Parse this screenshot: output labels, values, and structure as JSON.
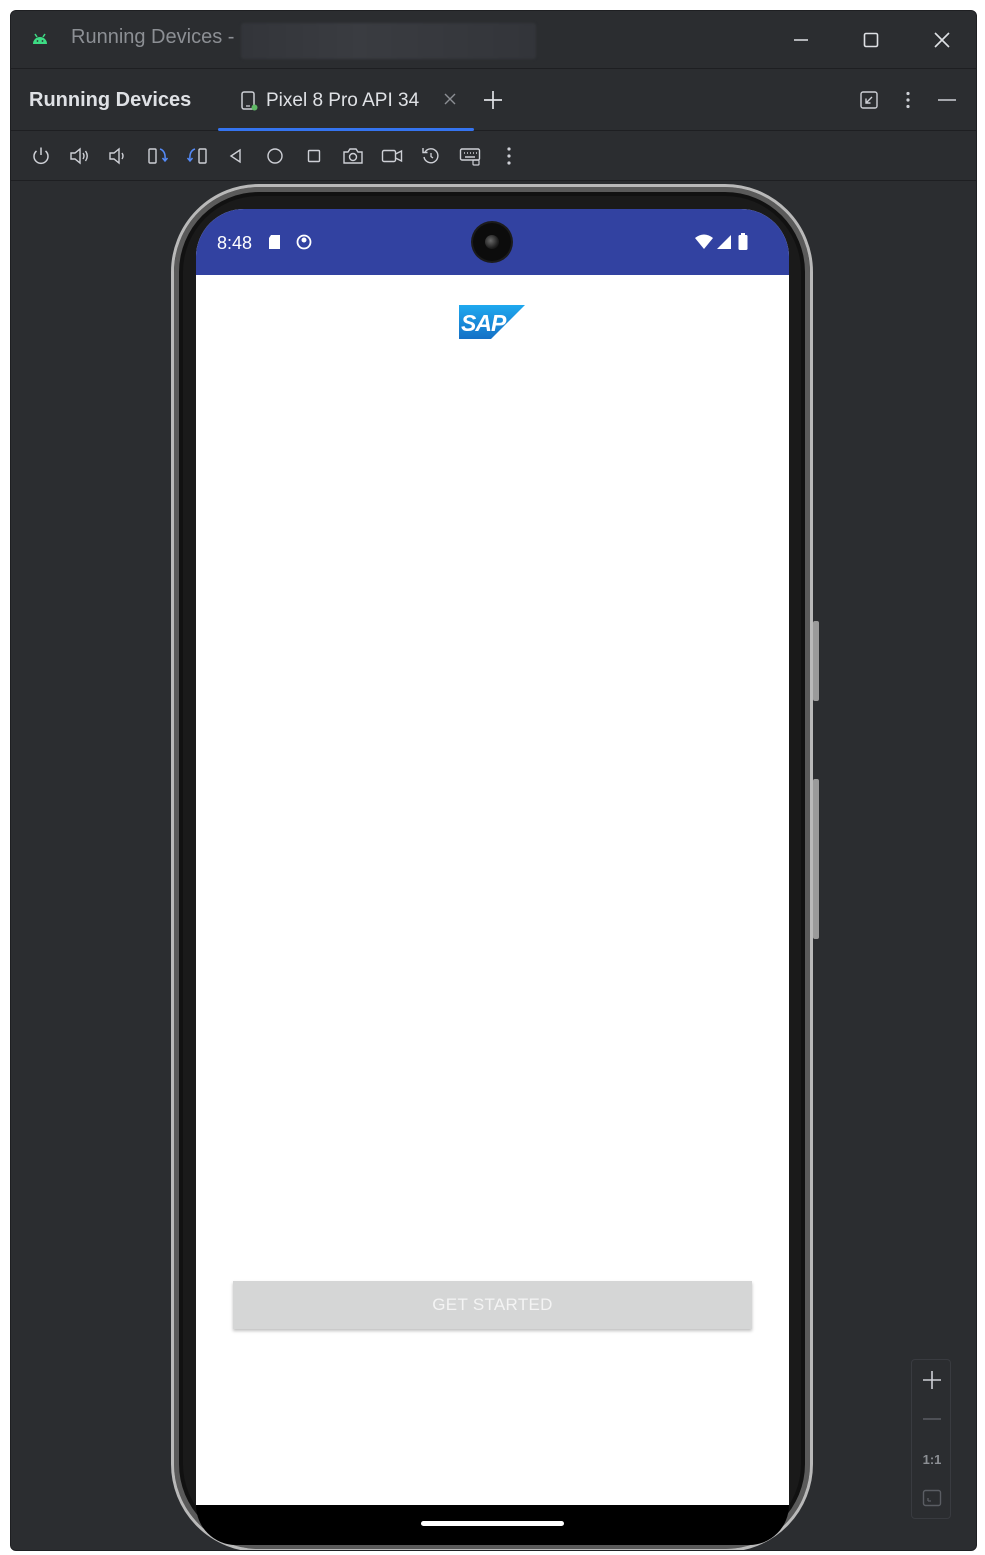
{
  "titlebar": {
    "app_icon": "android-icon",
    "title": "Running Devices -",
    "controls": [
      "minimize-icon",
      "maximize-icon",
      "close-icon"
    ]
  },
  "tool_window": {
    "title": "Running Devices",
    "tab": {
      "icon": "device-icon",
      "label": "Pixel 8 Pro API 34"
    },
    "add_tab_icon": "plus-icon",
    "header_actions": [
      "restore-icon",
      "more-vertical-icon",
      "hide-icon"
    ]
  },
  "toolbar": {
    "buttons": [
      "power-icon",
      "volume-up-icon",
      "volume-down-icon",
      "rotate-left-icon",
      "rotate-right-icon",
      "back-icon",
      "home-icon",
      "overview-icon",
      "screenshot-icon",
      "screen-record-icon",
      "reset-icon",
      "keyboard-icon",
      "more-vertical-icon"
    ]
  },
  "device": {
    "status_bar": {
      "time": "8:48",
      "color": "#3242a1"
    },
    "logo_text": "SAP",
    "get_started_label": "GET STARTED"
  },
  "zoom_panel": {
    "actual_size_label": "1:1"
  }
}
